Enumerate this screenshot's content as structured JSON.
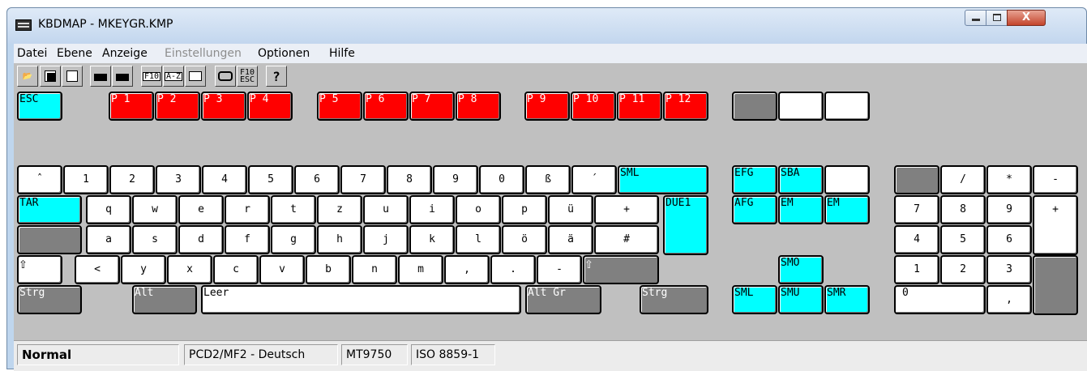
{
  "window": {
    "title": "KBDMAP - MKEYGR.KMP",
    "close_label": "X"
  },
  "menu": [
    "Datei",
    "Ebene",
    "Anzeige",
    "Einstellungen",
    "Optionen",
    "Hilfe"
  ],
  "menu_disabled": [
    "Einstellungen"
  ],
  "toolbar": {
    "f10": "F10",
    "az": "A-Z",
    "f10esc_1": "F10",
    "f10esc_2": "ESC",
    "help": "?"
  },
  "fkeys": {
    "esc": "ESC",
    "p": [
      "P 1",
      "P 2",
      "P 3",
      "P 4",
      "P 5",
      "P 6",
      "P 7",
      "P 8",
      "P 9",
      "P 10",
      "P 11",
      "P 12"
    ]
  },
  "rows": {
    "num_row": [
      "ˆ",
      "1",
      "2",
      "3",
      "4",
      "5",
      "6",
      "7",
      "8",
      "9",
      "0",
      "ß",
      "´"
    ],
    "num_row_end": "SML",
    "q_row_start": "TAR",
    "q_row": [
      "q",
      "w",
      "e",
      "r",
      "t",
      "z",
      "u",
      "i",
      "o",
      "p",
      "ü",
      "+"
    ],
    "enter": "DUE1",
    "a_row": [
      "a",
      "s",
      "d",
      "f",
      "g",
      "h",
      "j",
      "k",
      "l",
      "ö",
      "ä",
      "#"
    ],
    "shift_glyph": "⇧",
    "y_row": [
      "<",
      "y",
      "x",
      "c",
      "v",
      "b",
      "n",
      "m",
      ",",
      ".",
      "-"
    ],
    "bottom": {
      "ctrl_left": "Strg",
      "alt": "Alt",
      "space": "Leer",
      "altgr": "Alt Gr",
      "ctrl_right": "Strg"
    }
  },
  "nav": {
    "efg": "EFG",
    "sba": "SBA",
    "afg": "AFG",
    "em1": "EM",
    "em2": "EM",
    "smo": "SMO",
    "sml": "SML",
    "smu": "SMU",
    "smr": "SMR"
  },
  "numpad": {
    "slash": "/",
    "star": "*",
    "minus": "-",
    "r1": [
      "7",
      "8",
      "9"
    ],
    "plus": "+",
    "r2": [
      "4",
      "5",
      "6"
    ],
    "r3": [
      "1",
      "2",
      "3"
    ],
    "zero": "0",
    "comma": ","
  },
  "status": {
    "mode": "Normal",
    "layout": "PCD2/MF2 - Deutsch",
    "terminal": "MT9750",
    "charset": "ISO 8859-1"
  }
}
